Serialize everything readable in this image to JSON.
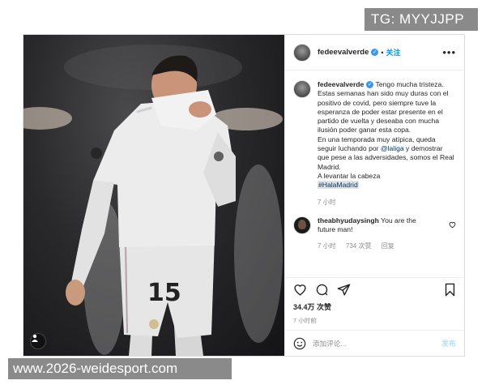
{
  "watermarks": {
    "top": "TG: MYYJJPP",
    "bottom": "www.2026-weidesport.com"
  },
  "post": {
    "username": "fedeevalverde",
    "dot": "•",
    "follow_label": "关注",
    "more_label": "•••",
    "caption": {
      "username": "fedeevalverde",
      "text_part1": " Tengo mucha tristeza. Estas semanas han sido muy duras con el positivo de covid, pero siempre tuve la esperanza de poder estar presente en el partido de vuelta y deseaba con mucha ilusión poder ganar esta copa.\nEn una temporada muy atípica, queda seguir luchando por ",
      "mention": "@laliga",
      "text_part2": " y demostrar que pese a las adversidades, somos el Real Madrid.\nA levantar la cabeza\n",
      "hashtag": "#HalaMadrid",
      "time": "7 小时"
    },
    "comment": {
      "username": "theabhyudaysingh",
      "text": " You are the future man!",
      "time": "7 小时",
      "likes": "734 次赞",
      "reply": "回复"
    },
    "likes_count": "34.4万 次赞",
    "time_ago": "7 小时前",
    "comment_placeholder": "添加评论...",
    "post_label": "发布",
    "jersey_number": "15",
    "icons": {
      "like": "heart-icon",
      "comment": "comment-bubble-icon",
      "share": "paper-plane-icon",
      "save": "bookmark-icon",
      "emoji": "smiley-icon",
      "verified": "verified-badge-icon"
    }
  }
}
